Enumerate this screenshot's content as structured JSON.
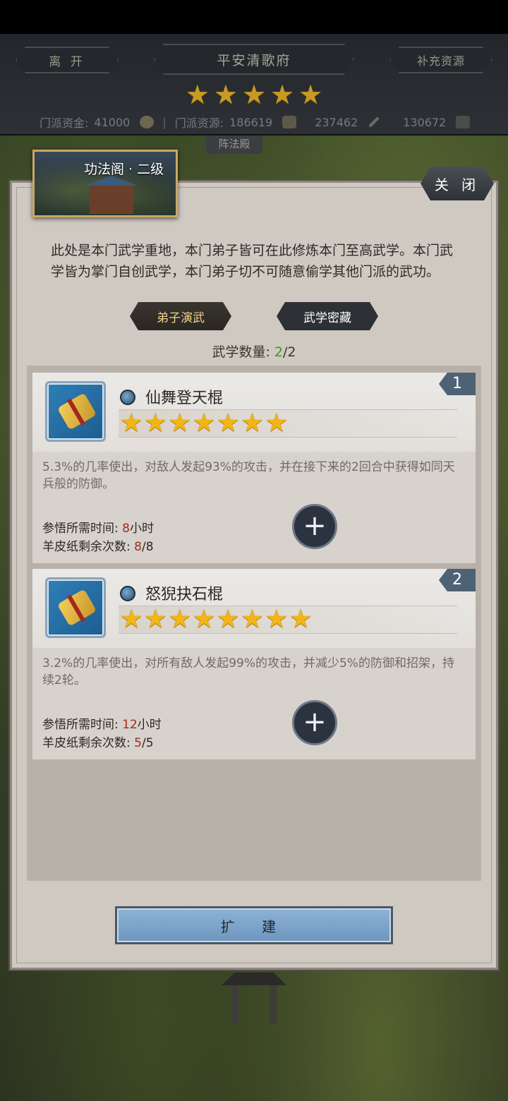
{
  "header": {
    "leave_label": "离 开",
    "sect_name": "平安清歌府",
    "supply_label": "补充资源",
    "star_count": 5,
    "resources": {
      "funds_label": "门派资金:",
      "funds_value": "41000",
      "separator": "|",
      "res_label": "门派资源:",
      "res_value": "186619",
      "res2_value": "237462",
      "res3_value": "130672"
    },
    "behind_tag": "阵法殿"
  },
  "panel": {
    "pavilion_title": "功法阁 · 二级",
    "close_label": "关 闭",
    "description": "此处是本门武学重地，本门弟子皆可在此修炼本门至高武学。本门武学皆为掌门自创武学，本门弟子切不可随意偷学其他门派的武功。",
    "tab_disciple": "弟子演武",
    "tab_secret": "武学密藏",
    "count_label": "武学数量:",
    "count_current": "2",
    "count_total": "/2",
    "expand_label": "扩 建"
  },
  "skills": [
    {
      "index": "1",
      "name": "仙舞登天棍",
      "stars": 7,
      "description": "5.3%的几率使出，对敌人发起93%的攻击，并在接下来的2回合中获得如同天兵般的防御。",
      "time_label": "参悟所需时间:",
      "time_value": "8",
      "time_unit": "小时",
      "parchment_label": "羊皮纸剩余次数:",
      "parchment_current": "8",
      "parchment_total": "/8"
    },
    {
      "index": "2",
      "name": "怒猊抉石棍",
      "stars": 8,
      "description": "3.2%的几率使出，对所有敌人发起99%的攻击，并减少5%的防御和招架，持续2轮。",
      "time_label": "参悟所需时间:",
      "time_value": "12",
      "time_unit": "小时",
      "parchment_label": "羊皮纸剩余次数:",
      "parchment_current": "5",
      "parchment_total": "/5"
    }
  ],
  "icons": {
    "star": "★",
    "add": "+",
    "funds": "coin-icon",
    "resource": "bag-icon",
    "weapon": "sword-icon",
    "box": "chest-icon"
  },
  "colors": {
    "star_gold": "#f1b516",
    "count_green": "#3b9a2a",
    "value_red": "#a52a1e",
    "badge_blue": "#4e6275"
  }
}
